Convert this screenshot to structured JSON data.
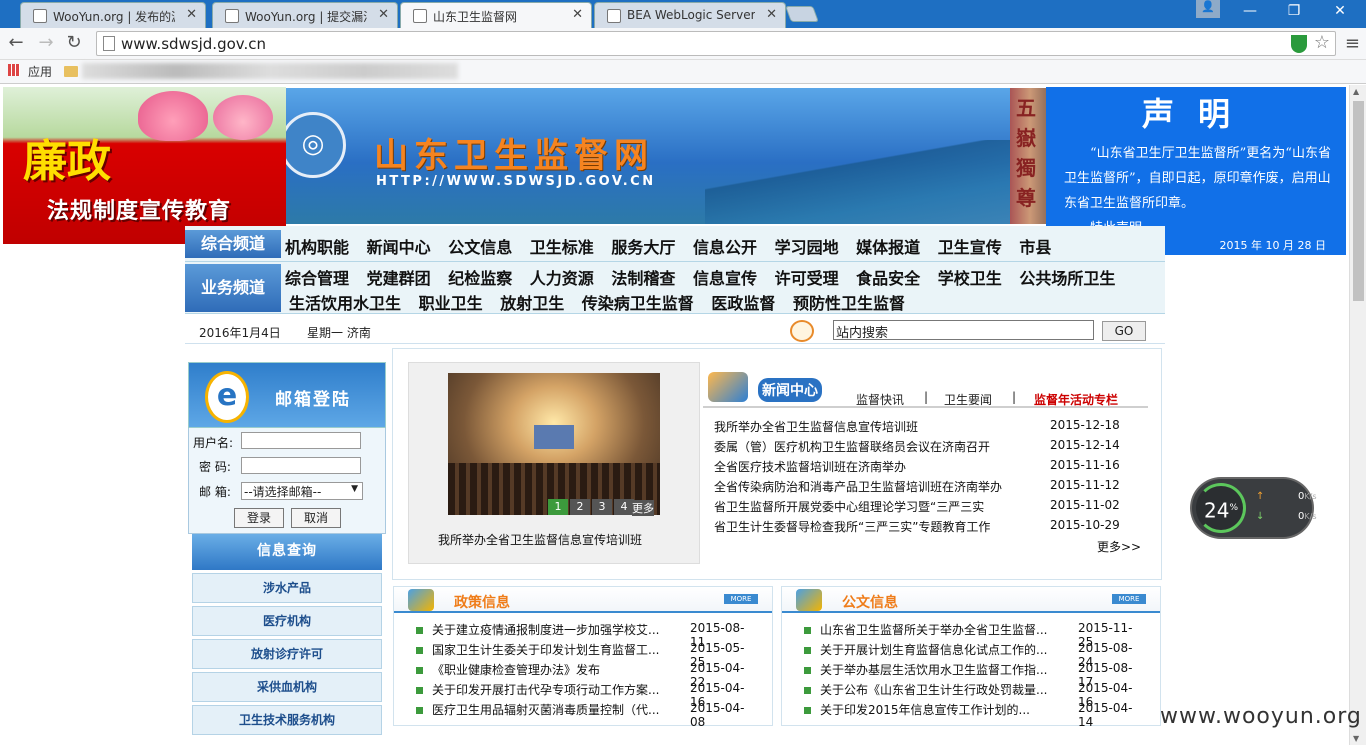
{
  "browser": {
    "tabs": [
      {
        "title": "WooYun.org | 发布的漏洞",
        "active": false
      },
      {
        "title": "WooYun.org | 提交漏洞",
        "active": false
      },
      {
        "title": "山东卫生监督网",
        "active": true
      },
      {
        "title": "BEA WebLogic Server Ad",
        "active": false
      }
    ],
    "close_glyph": "✕",
    "url": "www.sdwsjd.gov.cn",
    "bookmarks_label": "应用",
    "window_controls": [
      "—",
      "❐",
      "✕"
    ],
    "nav_glyphs": {
      "back": "←",
      "forward": "→",
      "reload": "↻",
      "star": "☆",
      "menu": "≡",
      "user": "👤"
    }
  },
  "ad_banner": {
    "title": "廉政",
    "subtitle": "法规制度宣传教育"
  },
  "header": {
    "site_title": "山东卫生监督网",
    "site_url": "HTTP://WWW.SDWSJD.GOV.CN",
    "rock_text": [
      "五",
      "嶽",
      "獨",
      "尊"
    ]
  },
  "notice": {
    "title": "声明",
    "body": "“山东省卫生厅卫生监督所”更名为“山东省卫生监督所”，自即日起，原印章作废，启用山东省卫生监督所印章。",
    "signoff": "特此声明。",
    "date": "2015 年 10 月 28 日"
  },
  "channels": {
    "general_label": "综合频道",
    "general_links": [
      "机构职能",
      "新闻中心",
      "公文信息",
      "卫生标准",
      "服务大厅",
      "信息公开",
      "学习园地",
      "媒体报道",
      "卫生宣传",
      "市县"
    ],
    "business_label": "业务频道",
    "business_links_1": [
      "综合管理",
      "党建群团",
      "纪检监察",
      "人力资源",
      "法制稽查",
      "信息宣传",
      "许可受理",
      "食品安全",
      "学校卫生",
      "公共场所卫生"
    ],
    "business_links_2": [
      "生活饮用水卫生",
      "职业卫生",
      "放射卫生",
      "传染病卫生监督",
      "医政监督",
      "预防性卫生监督"
    ]
  },
  "infobar": {
    "date": "2016年1月4日",
    "weekday": "星期一 济南",
    "search_value": "站内搜索",
    "go": "GO"
  },
  "mail": {
    "title": "邮箱登陆",
    "username_label": "用户名:",
    "password_label": "密  码:",
    "mailbox_label": "邮  箱:",
    "mailbox_select": "--请选择邮箱--",
    "login": "登录",
    "cancel": "取消"
  },
  "query": {
    "title": "信息查询",
    "items": [
      "涉水产品",
      "医疗机构",
      "放射诊疗许可",
      "采供血机构",
      "卫生技术服务机构"
    ]
  },
  "slideshow": {
    "caption": "我所举办全省卫生监督信息宣传培训班",
    "pages": [
      "1",
      "2",
      "3",
      "4"
    ],
    "more": "更多"
  },
  "news": {
    "title": "新闻中心",
    "tabs": [
      "监督快讯",
      "卫生要闻",
      "监督年活动专栏"
    ],
    "sep": "|",
    "items": [
      {
        "title": "我所举办全省卫生监督信息宣传培训班",
        "date": "2015-12-18"
      },
      {
        "title": "委属（管）医疗机构卫生监督联络员会议在济南召开",
        "date": "2015-12-14"
      },
      {
        "title": "全省医疗技术监督培训班在济南举办",
        "date": "2015-11-16"
      },
      {
        "title": "全省传染病防治和消毒产品卫生监督培训班在济南举办",
        "date": "2015-11-12"
      },
      {
        "title": "省卫生监督所开展党委中心组理论学习暨“三严三实",
        "date": "2015-11-02"
      },
      {
        "title": "省卫生计生委督导检查我所“三严三实”专题教育工作",
        "date": "2015-10-29"
      }
    ],
    "more": "更多>>"
  },
  "policy": {
    "title": "政策信息",
    "more": "MORE",
    "items": [
      {
        "title": "关于建立疫情通报制度进一步加强学校艾...",
        "date": "2015-08-11"
      },
      {
        "title": "国家卫生计生委关于印发计划生育监督工...",
        "date": "2015-05-25"
      },
      {
        "title": "《职业健康检查管理办法》发布",
        "date": "2015-04-22"
      },
      {
        "title": "关于印发开展打击代孕专项行动工作方案...",
        "date": "2015-04-16"
      },
      {
        "title": "医疗卫生用品辐射灭菌消毒质量控制（代...",
        "date": "2015-04-08"
      }
    ]
  },
  "documents": {
    "title": "公文信息",
    "more": "MORE",
    "items": [
      {
        "title": "山东省卫生监督所关于举办全省卫生监督...",
        "date": "2015-11-25"
      },
      {
        "title": "关于开展计划生育监督信息化试点工作的...",
        "date": "2015-08-24"
      },
      {
        "title": "关于举办基层生活饮用水卫生监督工作指...",
        "date": "2015-08-17"
      },
      {
        "title": "关于公布《山东省卫生计生行政处罚裁量...",
        "date": "2015-04-16"
      },
      {
        "title": "关于印发2015年信息宣传工作计划的...",
        "date": "2015-04-14"
      }
    ]
  },
  "net_widget": {
    "percent": "24",
    "unit": "%",
    "up": "0",
    "down": "0",
    "rate_unit": "K/s",
    "up_arrow": "↑",
    "down_arrow": "↓"
  },
  "watermark": "www.wooyun.org"
}
